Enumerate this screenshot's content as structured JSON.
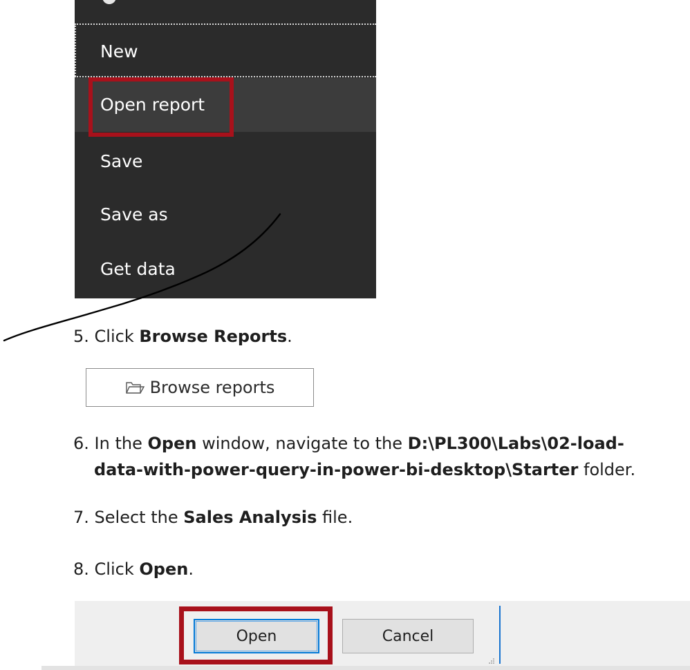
{
  "menu": {
    "items": [
      {
        "label": "New"
      },
      {
        "label": "Open report"
      },
      {
        "label": "Save"
      },
      {
        "label": "Save as"
      },
      {
        "label": "Get data"
      }
    ],
    "background": "#2b2b2b",
    "selected_background": "#3c3c3c",
    "highlight_color": "#a8111b"
  },
  "steps": {
    "s5": {
      "num": "5.",
      "pre": "Click ",
      "bold": "Browse Reports",
      "post": "."
    },
    "browse_button": {
      "label": "Browse reports",
      "icon": "folder-open-icon"
    },
    "s6": {
      "num": "6.",
      "pre": "In the ",
      "bold1": "Open",
      "mid": " window, navigate to the ",
      "bold2a": "D:\\PL300\\Labs\\02-load-",
      "bold2b": "data-with-power-query-in-power-bi-desktop\\Starter",
      "post": " folder."
    },
    "s7": {
      "num": "7.",
      "pre": "Select the ",
      "bold": "Sales Analysis",
      "post": " file."
    },
    "s8": {
      "num": "8.",
      "pre": "Click ",
      "bold": "Open",
      "post": "."
    }
  },
  "dialog": {
    "open_label": "Open",
    "cancel_label": "Cancel",
    "accent": "#0078d7"
  }
}
